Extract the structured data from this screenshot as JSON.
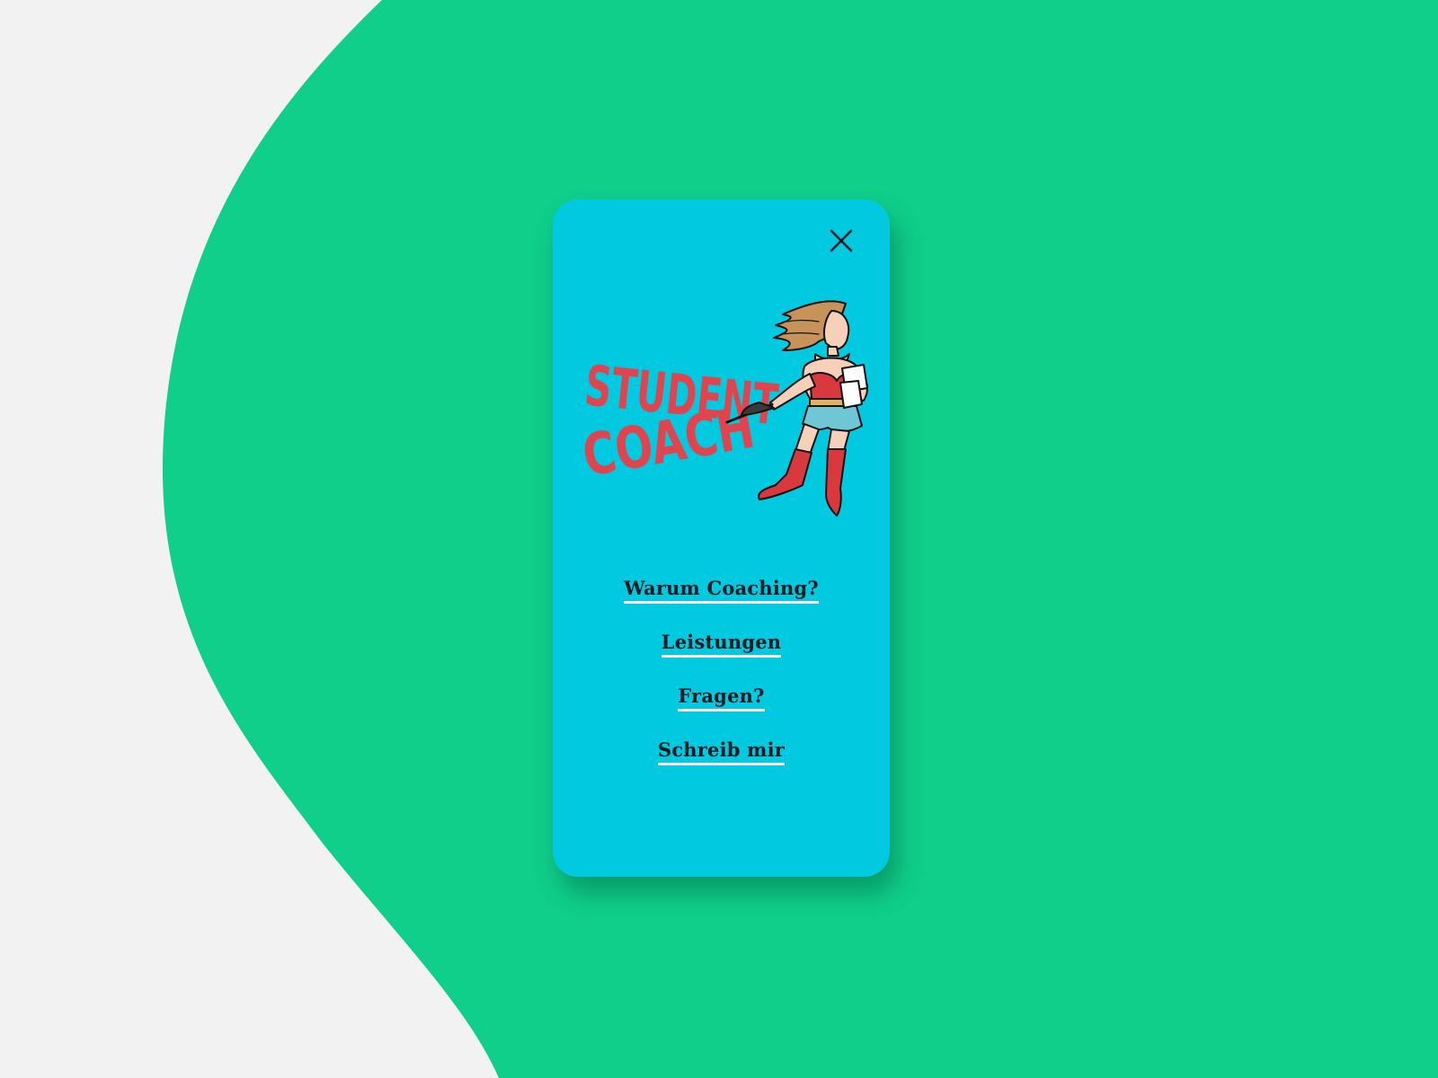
{
  "colors": {
    "page_background": "#f2f2f2",
    "blob": "#0fcf8b",
    "phone_background": "#00c9e0",
    "logo_text": "#e0444e",
    "link_text": "#0b1a20",
    "link_underline": "#ffffff"
  },
  "header": {
    "close_icon": "close-icon"
  },
  "logo": {
    "line1": "STUDENT",
    "line2": "COACH",
    "illustration": "flying-superhero-woman-illustration"
  },
  "nav": {
    "items": [
      {
        "label": "Warum Coaching?"
      },
      {
        "label": "Leistungen"
      },
      {
        "label": "Fragen?"
      },
      {
        "label": "Schreib mir"
      }
    ]
  }
}
